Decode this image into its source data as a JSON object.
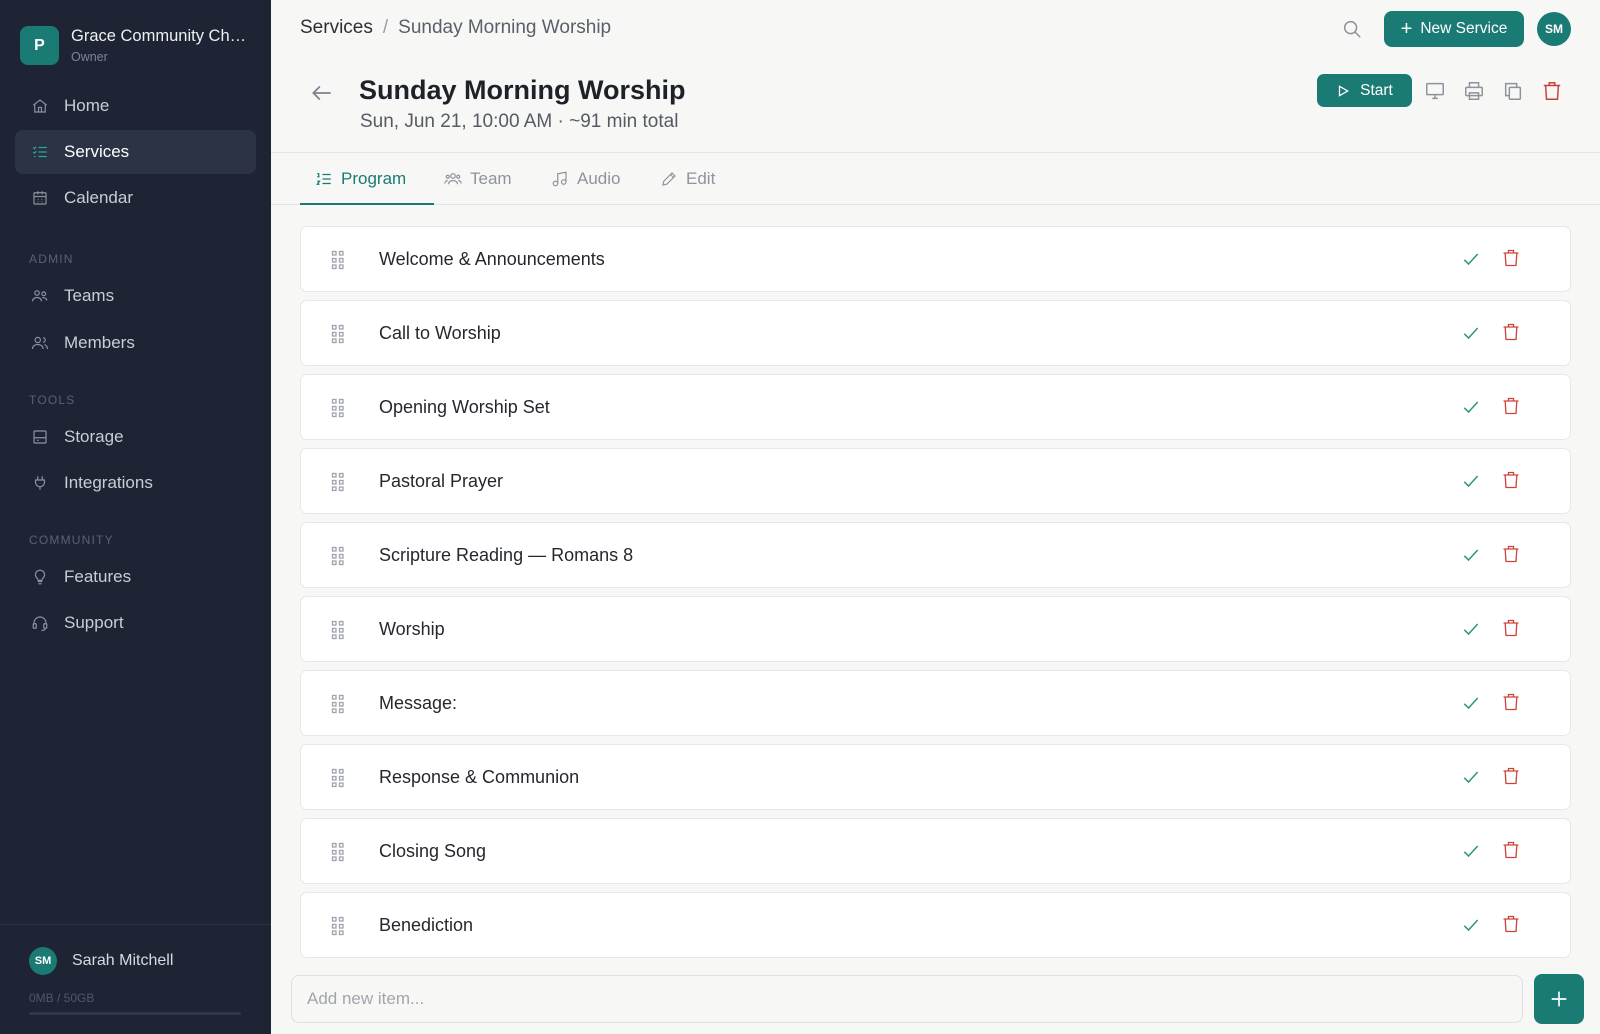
{
  "org": {
    "initial": "P",
    "name": "Grace Community Church",
    "role": "Owner"
  },
  "nav": {
    "main": [
      {
        "label": "Home",
        "icon": "home-icon"
      },
      {
        "label": "Services",
        "icon": "list-check-icon",
        "active": true
      },
      {
        "label": "Calendar",
        "icon": "calendar-icon"
      }
    ],
    "admin_label": "ADMIN",
    "admin": [
      {
        "label": "Teams",
        "icon": "teams-icon"
      },
      {
        "label": "Members",
        "icon": "members-icon"
      }
    ],
    "tools_label": "TOOLS",
    "tools": [
      {
        "label": "Storage",
        "icon": "storage-icon"
      },
      {
        "label": "Integrations",
        "icon": "plug-icon"
      }
    ],
    "community_label": "COMMUNITY",
    "community": [
      {
        "label": "Features",
        "icon": "lightbulb-icon"
      },
      {
        "label": "Support",
        "icon": "headset-icon"
      }
    ]
  },
  "user": {
    "initials": "SM",
    "name": "Sarah Mitchell",
    "storage": "0MB / 50GB"
  },
  "topbar": {
    "crumb_root": "Services",
    "crumb_sep": "/",
    "crumb_current": "Sunday Morning Worship",
    "new_service_label": "New Service",
    "avatar_initials": "SM"
  },
  "service": {
    "title": "Sunday Morning Worship",
    "subtitle": "Sun, Jun 21, 10:00 AM · ~91 min total",
    "start_label": "Start"
  },
  "tabs": [
    {
      "label": "Program",
      "icon": "program-list-icon",
      "active": true
    },
    {
      "label": "Team",
      "icon": "team-icon"
    },
    {
      "label": "Audio",
      "icon": "music-note-icon"
    },
    {
      "label": "Edit",
      "icon": "pencil-icon"
    }
  ],
  "program_items": [
    "Welcome & Announcements",
    "Call to Worship",
    "Opening Worship Set",
    "Pastoral Prayer",
    "Scripture Reading — Romans 8",
    "Worship",
    "Message:",
    "Response & Communion",
    "Closing Song",
    "Benediction"
  ],
  "add_item": {
    "placeholder": "Add new item..."
  },
  "colors": {
    "accent": "#1a7a74",
    "sidebar_bg": "#1e2433",
    "check": "#2e9a6a",
    "danger": "#d0433c"
  }
}
